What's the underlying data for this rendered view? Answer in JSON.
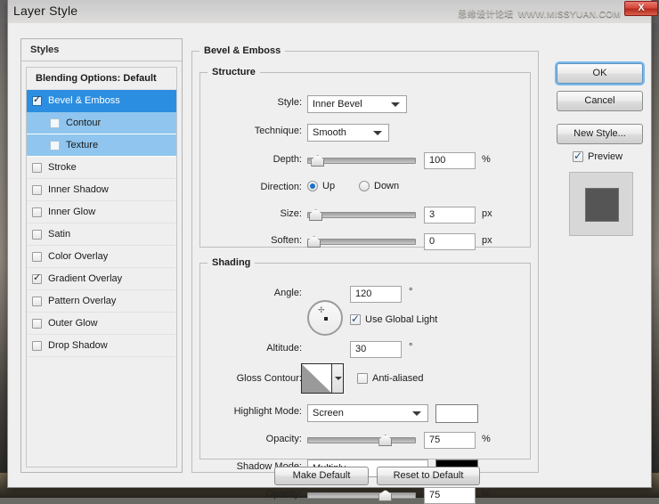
{
  "window": {
    "title": "Layer Style",
    "watermark_cn": "思缘设计论坛",
    "watermark_url": "WWW.MISSYUAN.COM",
    "close_label": "X"
  },
  "styles_panel": {
    "header": "Styles",
    "items": [
      {
        "label": "Blending Options: Default",
        "checkbox": false,
        "state": "header",
        "level": 0
      },
      {
        "label": "Bevel & Emboss",
        "checkbox": true,
        "checked": true,
        "state": "selected",
        "level": 0
      },
      {
        "label": "Contour",
        "checkbox": true,
        "checked": false,
        "state": "sub",
        "level": 1
      },
      {
        "label": "Texture",
        "checkbox": true,
        "checked": false,
        "state": "sub",
        "level": 1
      },
      {
        "label": "Stroke",
        "checkbox": true,
        "checked": false,
        "state": "normal",
        "level": 0
      },
      {
        "label": "Inner Shadow",
        "checkbox": true,
        "checked": false,
        "state": "normal",
        "level": 0
      },
      {
        "label": "Inner Glow",
        "checkbox": true,
        "checked": false,
        "state": "normal",
        "level": 0
      },
      {
        "label": "Satin",
        "checkbox": true,
        "checked": false,
        "state": "normal",
        "level": 0
      },
      {
        "label": "Color Overlay",
        "checkbox": true,
        "checked": false,
        "state": "normal",
        "level": 0
      },
      {
        "label": "Gradient Overlay",
        "checkbox": true,
        "checked": true,
        "state": "normal",
        "level": 0
      },
      {
        "label": "Pattern Overlay",
        "checkbox": true,
        "checked": false,
        "state": "normal",
        "level": 0
      },
      {
        "label": "Outer Glow",
        "checkbox": true,
        "checked": false,
        "state": "normal",
        "level": 0
      },
      {
        "label": "Drop Shadow",
        "checkbox": true,
        "checked": false,
        "state": "normal",
        "level": 0
      }
    ]
  },
  "main": {
    "group_title": "Bevel & Emboss",
    "structure": {
      "title": "Structure",
      "style_label": "Style:",
      "style_value": "Inner Bevel",
      "technique_label": "Technique:",
      "technique_value": "Smooth",
      "depth_label": "Depth:",
      "depth_value": "100",
      "depth_unit": "%",
      "depth_percent": 4,
      "direction_label": "Direction:",
      "direction_up": "Up",
      "direction_down": "Down",
      "direction_selected": "Up",
      "size_label": "Size:",
      "size_value": "3",
      "size_unit": "px",
      "size_percent": 2,
      "soften_label": "Soften:",
      "soften_value": "0",
      "soften_unit": "px",
      "soften_percent": 0
    },
    "shading": {
      "title": "Shading",
      "angle_label": "Angle:",
      "angle_value": "120",
      "angle_unit": "°",
      "use_global_light_label": "Use Global Light",
      "use_global_light_checked": true,
      "altitude_label": "Altitude:",
      "altitude_value": "30",
      "altitude_unit": "°",
      "gloss_contour_label": "Gloss Contour:",
      "anti_aliased_label": "Anti-aliased",
      "anti_aliased_checked": false,
      "highlight_mode_label": "Highlight Mode:",
      "highlight_mode_value": "Screen",
      "highlight_color": "#ffffff",
      "highlight_opacity_label": "Opacity:",
      "highlight_opacity_value": "75",
      "highlight_opacity_unit": "%",
      "highlight_opacity_percent": 75,
      "shadow_mode_label": "Shadow Mode:",
      "shadow_mode_value": "Multiply",
      "shadow_color": "#000000",
      "shadow_opacity_label": "Opacity:",
      "shadow_opacity_value": "75",
      "shadow_opacity_unit": "%",
      "shadow_opacity_percent": 75
    },
    "make_default_label": "Make Default",
    "reset_default_label": "Reset to Default"
  },
  "right_panel": {
    "ok_label": "OK",
    "cancel_label": "Cancel",
    "new_style_label": "New Style...",
    "preview_label": "Preview",
    "preview_checked": true,
    "preview_swatch_color": "#555555"
  },
  "colors": {
    "accent_selected": "#2c8ee0",
    "accent_sub": "#8fc5ee",
    "dialog_bg": "#efefef",
    "focus_ring": "#7cb8e8"
  }
}
